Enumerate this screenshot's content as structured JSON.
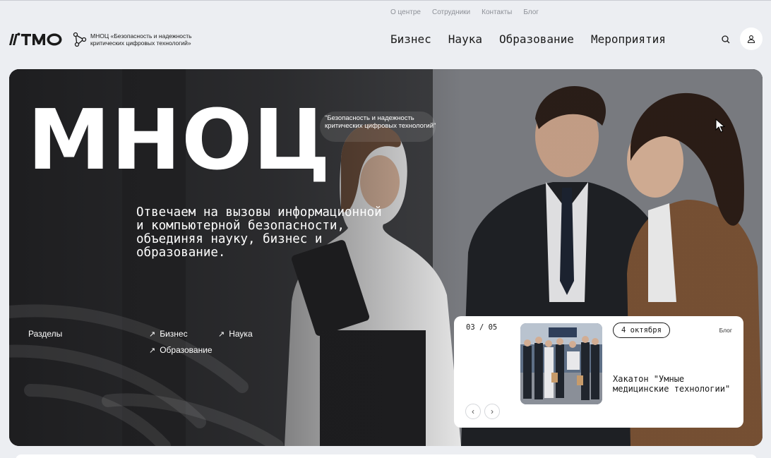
{
  "utility_links": [
    "О центре",
    "Сотрудники",
    "Контакты",
    "Блог"
  ],
  "header": {
    "logo_text": "ITMO",
    "center_name": "МНОЦ «Безопасность и надежность критических цифровых технологий»",
    "nav": [
      "Бизнес",
      "Наука",
      "Образование",
      "Мероприятия"
    ],
    "icons": {
      "search": "search-icon",
      "user": "user-icon",
      "center": "network-nodes-icon"
    }
  },
  "hero": {
    "title": "МНОЦ",
    "subtitle": "\"Безопасность и надежность критических цифровых технологий\"",
    "tagline": "Отвечаем на вызовы информационной и компьютерной безопасности, объединяя науку, бизнес и образование.",
    "sections_label": "Разделы",
    "sections": [
      "Бизнес",
      "Наука",
      "Образование"
    ]
  },
  "news": {
    "counter": "03 / 05",
    "date": "4 октября",
    "category": "Блог",
    "title": "Хакатон \"Умные медицинские технологии\""
  },
  "colors": {
    "page_bg": "#eceef2",
    "hero_dark": "#2c2c2e",
    "card_bg": "#ffffff",
    "text": "#1a1a1a"
  }
}
